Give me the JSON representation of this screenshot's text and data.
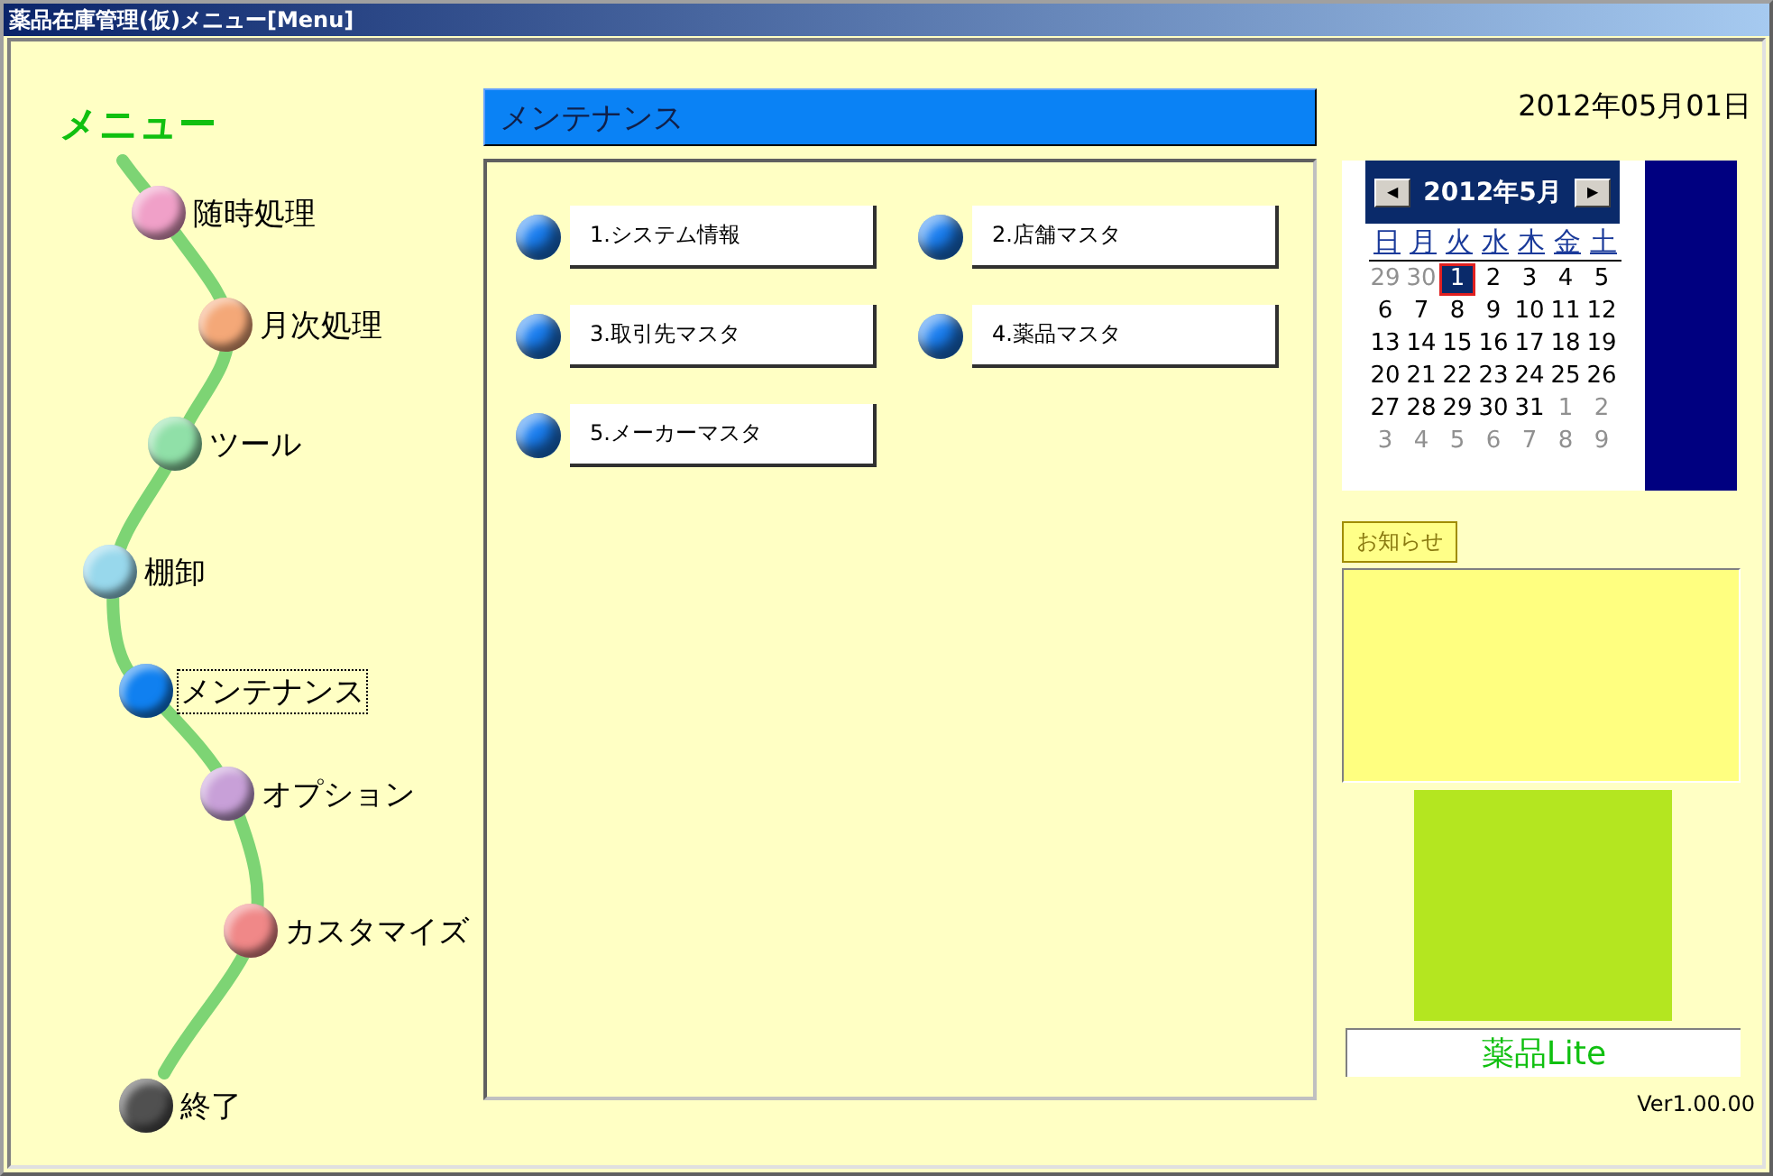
{
  "window": {
    "title": "薬品在庫管理(仮)メニュー[Menu]"
  },
  "menu": {
    "heading": "メニュー",
    "items": [
      {
        "label": "随時処理",
        "color": "#f0a0c8",
        "selected": false
      },
      {
        "label": "月次処理",
        "color": "#f4a878",
        "selected": false
      },
      {
        "label": "ツール",
        "color": "#90e0a8",
        "selected": false
      },
      {
        "label": "棚卸",
        "color": "#98d8ec",
        "selected": false
      },
      {
        "label": "メンテナンス",
        "color": "#1080f0",
        "selected": true
      },
      {
        "label": "オプション",
        "color": "#c8a0d8",
        "selected": false
      },
      {
        "label": "カスタマイズ",
        "color": "#f08888",
        "selected": false
      },
      {
        "label": "終了",
        "color": "#505050",
        "selected": false
      }
    ]
  },
  "panel": {
    "title": "メンテナンス",
    "buttons": [
      "1.システム情報",
      "2.店舗マスタ",
      "3.取引先マスタ",
      "4.薬品マスタ",
      "5.メーカーマスタ"
    ]
  },
  "date": "2012年05月01日",
  "calendar": {
    "month": "2012年5月",
    "prev": "◀",
    "next": "▶",
    "weekdays": [
      "日",
      "月",
      "火",
      "水",
      "木",
      "金",
      "土"
    ],
    "days": [
      {
        "label": "29",
        "outside": true,
        "selected": false
      },
      {
        "label": "30",
        "outside": true,
        "selected": false
      },
      {
        "label": "1",
        "outside": false,
        "selected": true
      },
      {
        "label": "2",
        "outside": false,
        "selected": false
      },
      {
        "label": "3",
        "outside": false,
        "selected": false
      },
      {
        "label": "4",
        "outside": false,
        "selected": false
      },
      {
        "label": "5",
        "outside": false,
        "selected": false
      },
      {
        "label": "6",
        "outside": false,
        "selected": false
      },
      {
        "label": "7",
        "outside": false,
        "selected": false
      },
      {
        "label": "8",
        "outside": false,
        "selected": false
      },
      {
        "label": "9",
        "outside": false,
        "selected": false
      },
      {
        "label": "10",
        "outside": false,
        "selected": false
      },
      {
        "label": "11",
        "outside": false,
        "selected": false
      },
      {
        "label": "12",
        "outside": false,
        "selected": false
      },
      {
        "label": "13",
        "outside": false,
        "selected": false
      },
      {
        "label": "14",
        "outside": false,
        "selected": false
      },
      {
        "label": "15",
        "outside": false,
        "selected": false
      },
      {
        "label": "16",
        "outside": false,
        "selected": false
      },
      {
        "label": "17",
        "outside": false,
        "selected": false
      },
      {
        "label": "18",
        "outside": false,
        "selected": false
      },
      {
        "label": "19",
        "outside": false,
        "selected": false
      },
      {
        "label": "20",
        "outside": false,
        "selected": false
      },
      {
        "label": "21",
        "outside": false,
        "selected": false
      },
      {
        "label": "22",
        "outside": false,
        "selected": false
      },
      {
        "label": "23",
        "outside": false,
        "selected": false
      },
      {
        "label": "24",
        "outside": false,
        "selected": false
      },
      {
        "label": "25",
        "outside": false,
        "selected": false
      },
      {
        "label": "26",
        "outside": false,
        "selected": false
      },
      {
        "label": "27",
        "outside": false,
        "selected": false
      },
      {
        "label": "28",
        "outside": false,
        "selected": false
      },
      {
        "label": "29",
        "outside": false,
        "selected": false
      },
      {
        "label": "30",
        "outside": false,
        "selected": false
      },
      {
        "label": "31",
        "outside": false,
        "selected": false
      },
      {
        "label": "1",
        "outside": true,
        "selected": false
      },
      {
        "label": "2",
        "outside": true,
        "selected": false
      },
      {
        "label": "3",
        "outside": true,
        "selected": false
      },
      {
        "label": "4",
        "outside": true,
        "selected": false
      },
      {
        "label": "5",
        "outside": true,
        "selected": false
      },
      {
        "label": "6",
        "outside": true,
        "selected": false
      },
      {
        "label": "7",
        "outside": true,
        "selected": false
      },
      {
        "label": "8",
        "outside": true,
        "selected": false
      },
      {
        "label": "9",
        "outside": true,
        "selected": false
      }
    ]
  },
  "notice": {
    "tab": "お知らせ"
  },
  "logo": "薬品Lite",
  "version": "Ver1.00.00"
}
